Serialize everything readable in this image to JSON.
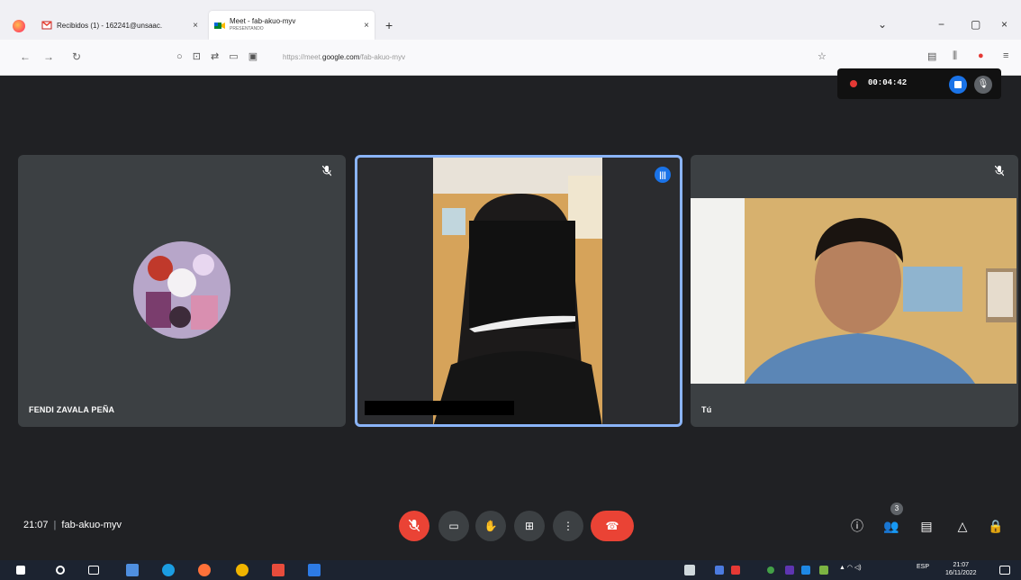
{
  "browser": {
    "tabs": [
      {
        "title": "Recibidos (1) - 162241@unsaac.",
        "subtitle": "",
        "active": false
      },
      {
        "title": "Meet - fab-akuo-myv",
        "subtitle": "PRESENTANDO",
        "active": true
      }
    ],
    "url_prefix": "https://meet.",
    "url_domain": "google.com",
    "url_path": "/fab-akuo-myv"
  },
  "recording": {
    "time": "00:04:42"
  },
  "participants": [
    {
      "name": "FENDI ZAVALA PEÑA",
      "muted": true
    },
    {
      "name": "",
      "speaking": true
    },
    {
      "name": "Tú",
      "muted": true
    }
  ],
  "meeting": {
    "time": "21:07",
    "separator": "|",
    "code": "fab-akuo-myv",
    "people_count": "3"
  },
  "taskbar": {
    "language": "ESP",
    "clock_time": "21:07",
    "clock_date": "16/11/2022"
  },
  "colors": {
    "stage_bg": "#202124",
    "tile_bg": "#3c4043",
    "accent_blue": "#1a73e8",
    "active_border": "#8ab4f8",
    "danger_red": "#ea4335"
  }
}
